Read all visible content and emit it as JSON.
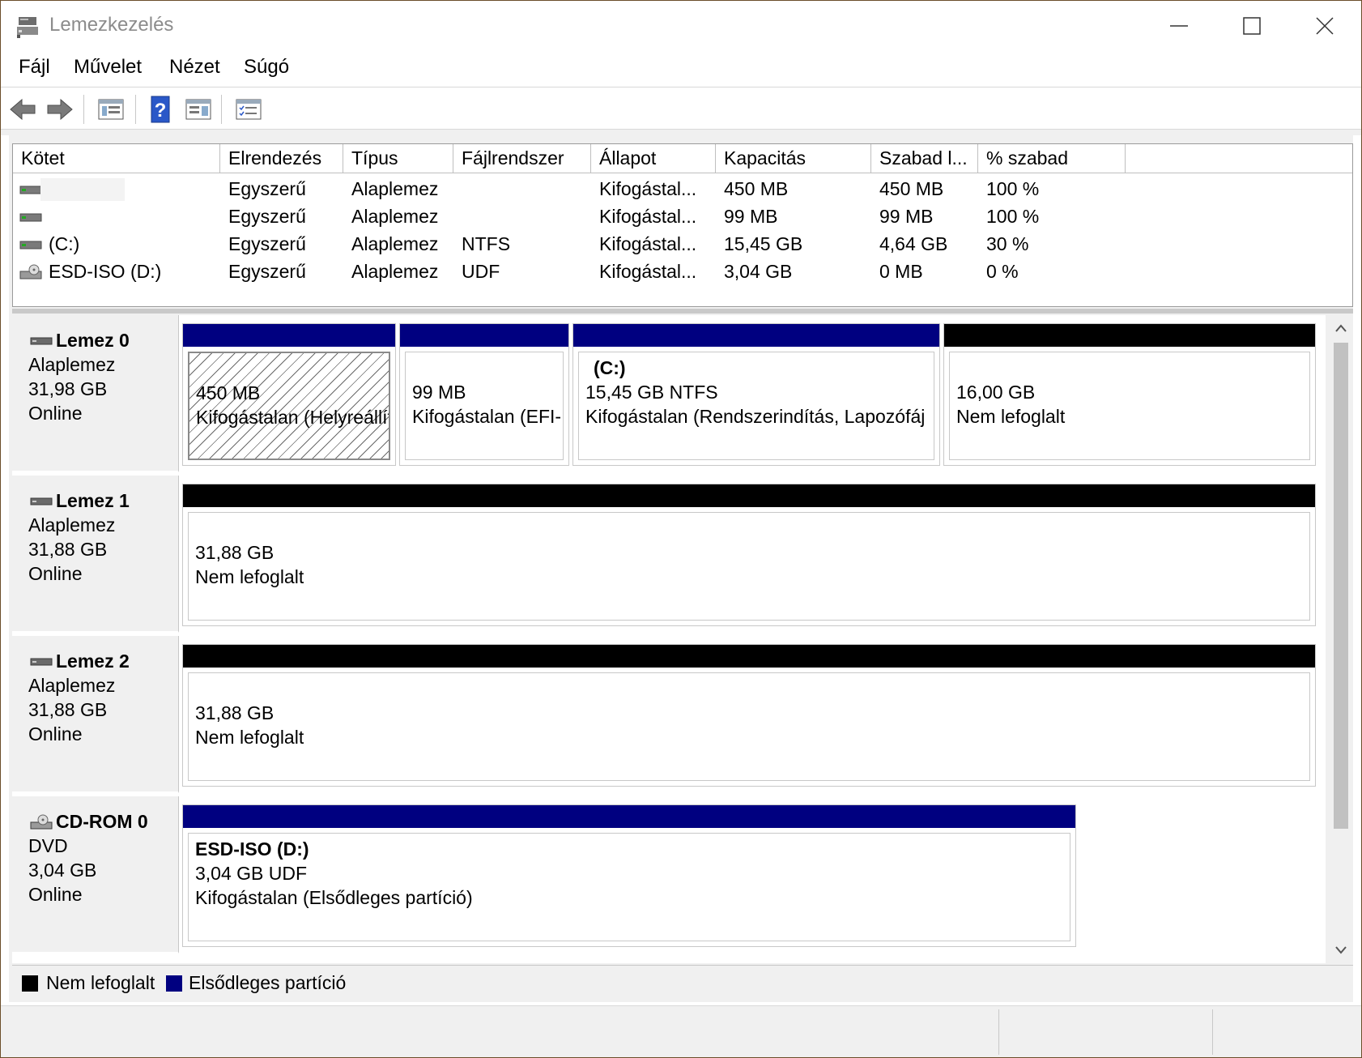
{
  "window": {
    "title": "Lemezkezelés"
  },
  "menu": {
    "items": [
      "Fájl",
      "Művelet",
      "Nézet",
      "Súgó"
    ]
  },
  "toolbar": {
    "buttons": [
      "back-arrow-icon",
      "forward-arrow-icon",
      "disk-list-icon",
      "help-icon",
      "properties-icon",
      "checklist-icon"
    ]
  },
  "volume_list": {
    "columns": [
      "Kötet",
      "Elrendezés",
      "Típus",
      "Fájlrendszer",
      "Állapot",
      "Kapacitás",
      "Szabad l...",
      "% szabad"
    ],
    "rows": [
      {
        "volume": "",
        "layout": "Egyszerű",
        "type": "Alaplemez",
        "fs": "",
        "status": "Kifogástal...",
        "capacity": "450 MB",
        "free": "450 MB",
        "pct": "100 %",
        "icon": "drive-icon"
      },
      {
        "volume": "",
        "layout": "Egyszerű",
        "type": "Alaplemez",
        "fs": "",
        "status": "Kifogástal...",
        "capacity": "99 MB",
        "free": "99 MB",
        "pct": "100 %",
        "icon": "drive-icon"
      },
      {
        "volume": "(C:)",
        "layout": "Egyszerű",
        "type": "Alaplemez",
        "fs": "NTFS",
        "status": "Kifogástal...",
        "capacity": "15,45 GB",
        "free": "4,64 GB",
        "pct": "30 %",
        "icon": "drive-icon"
      },
      {
        "volume": "ESD-ISO (D:)",
        "layout": "Egyszerű",
        "type": "Alaplemez",
        "fs": "UDF",
        "status": "Kifogástal...",
        "capacity": "3,04 GB",
        "free": "0 MB",
        "pct": "0 %",
        "icon": "cd-drive-icon"
      }
    ]
  },
  "disks": [
    {
      "name": "Lemez 0",
      "type": "Alaplemez",
      "size": "31,98 GB",
      "status": "Online",
      "icon": "disk-icon",
      "partitions": [
        {
          "title": "",
          "line1": "450 MB",
          "line2": "Kifogástalan (Helyreállít",
          "kind": "primary",
          "hatched": true
        },
        {
          "title": "",
          "line1": "99 MB",
          "line2": "Kifogástalan (EFI-",
          "kind": "primary",
          "hatched": false
        },
        {
          "title": "(C:)",
          "line1": "15,45 GB NTFS",
          "line2": "Kifogástalan (Rendszerindítás, Lapozófáj",
          "kind": "primary",
          "hatched": false
        },
        {
          "title": "",
          "line1": "16,00 GB",
          "line2": "Nem lefoglalt",
          "kind": "unallocated",
          "hatched": false
        }
      ]
    },
    {
      "name": "Lemez 1",
      "type": "Alaplemez",
      "size": "31,88 GB",
      "status": "Online",
      "icon": "disk-icon",
      "partitions": [
        {
          "title": "",
          "line1": "31,88 GB",
          "line2": "Nem lefoglalt",
          "kind": "unallocated",
          "hatched": false
        }
      ]
    },
    {
      "name": "Lemez 2",
      "type": "Alaplemez",
      "size": "31,88 GB",
      "status": "Online",
      "icon": "disk-icon",
      "partitions": [
        {
          "title": "",
          "line1": "31,88 GB",
          "line2": "Nem lefoglalt",
          "kind": "unallocated",
          "hatched": false
        }
      ]
    },
    {
      "name": "CD-ROM 0",
      "type": "DVD",
      "size": "3,04 GB",
      "status": "Online",
      "icon": "cd-rom-icon",
      "partitions": [
        {
          "title": "ESD-ISO  (D:)",
          "line1": "3,04 GB UDF",
          "line2": "Kifogástalan (Elsődleges partíció)",
          "kind": "primary",
          "hatched": false
        }
      ]
    }
  ],
  "legend": [
    {
      "label": "Nem lefoglalt",
      "color": "#000000"
    },
    {
      "label": "Elsődleges partíció",
      "color": "#000080"
    }
  ],
  "colors": {
    "primary": "#000080",
    "unallocated": "#000000"
  }
}
